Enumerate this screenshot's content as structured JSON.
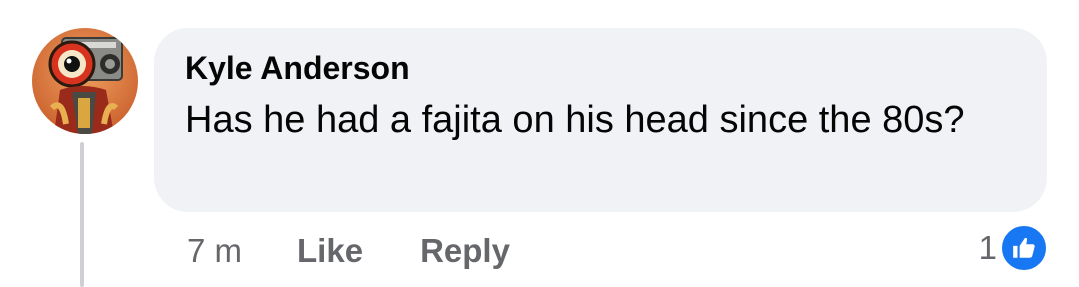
{
  "comment": {
    "author": "Kyle Anderson",
    "text": "Has he had a fajita on his head since the 80s?",
    "timestamp": "7 m",
    "like_label": "Like",
    "reply_label": "Reply",
    "reaction_count": "1",
    "reaction_type": "like-icon",
    "avatar_icon": "boombox-character-avatar"
  },
  "colors": {
    "bubble_bg": "#f0f2f5",
    "meta_text": "#65676b",
    "primary_text": "#050505",
    "like_blue": "#1877f2",
    "thread_line": "#ced0d4"
  }
}
